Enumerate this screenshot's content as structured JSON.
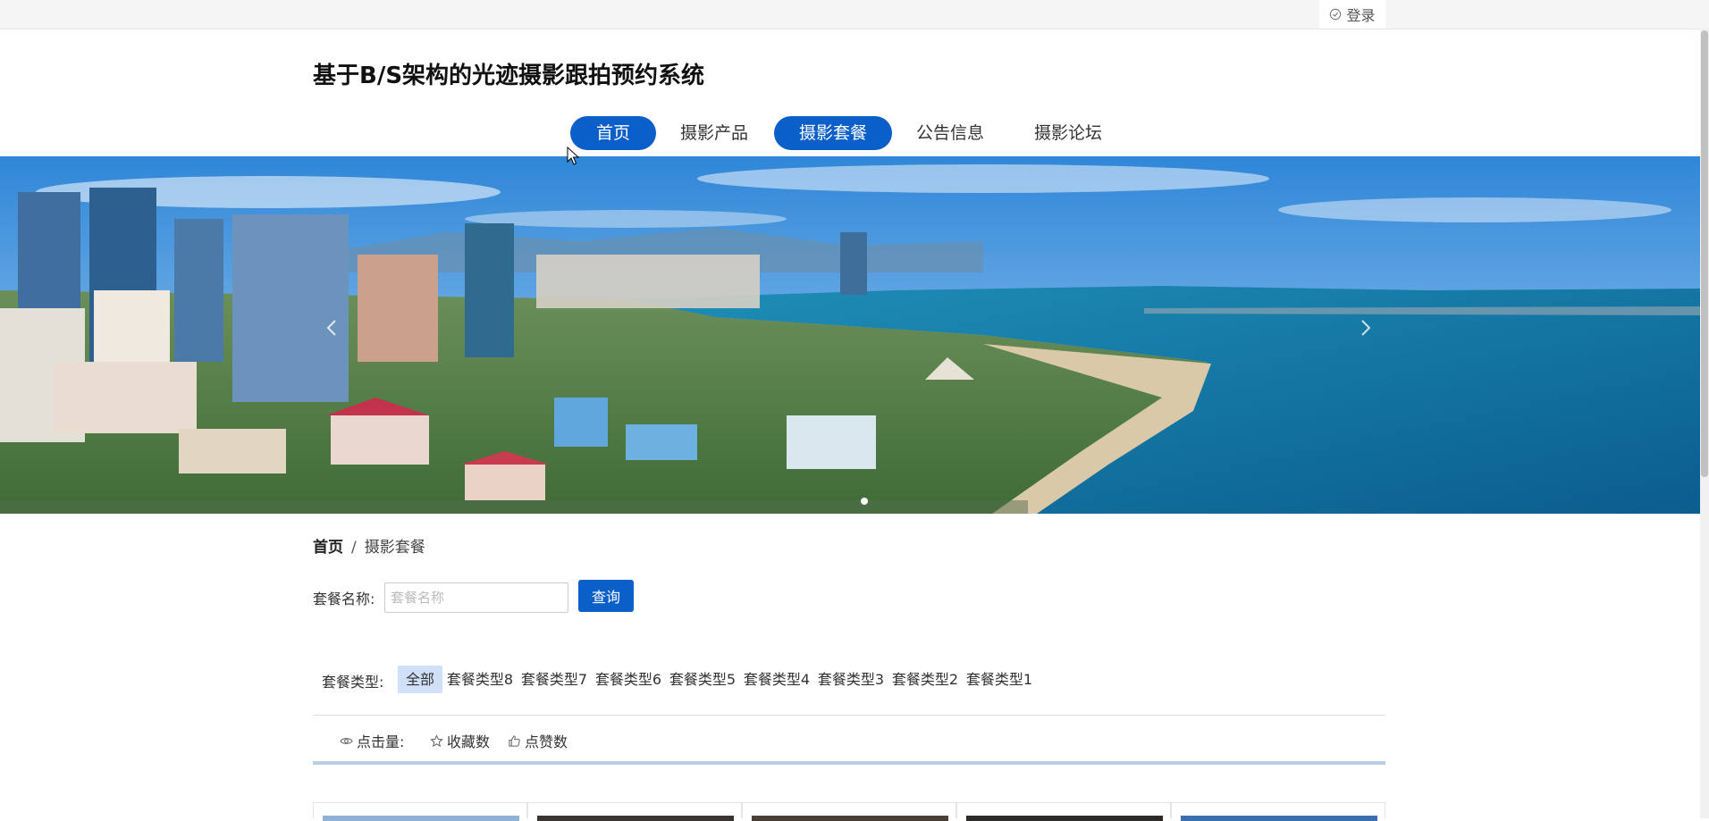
{
  "topbar": {
    "login_label": "登录",
    "login_icon": "check-circle-icon"
  },
  "site": {
    "title": "基于B/S架构的光迹摄影跟拍预约系统"
  },
  "nav": {
    "items": [
      {
        "label": "首页",
        "active": true
      },
      {
        "label": "摄影产品",
        "active": false
      },
      {
        "label": "摄影套餐",
        "active": true
      },
      {
        "label": "公告信息",
        "active": false
      },
      {
        "label": "摄影论坛",
        "active": false
      }
    ],
    "active_color": "#0b5fc8"
  },
  "banner": {
    "prev_icon": "chevron-left-icon",
    "next_icon": "chevron-right-icon"
  },
  "breadcrumb": {
    "home": "首页",
    "separator": "/",
    "current": "摄影套餐"
  },
  "search": {
    "label": "套餐名称:",
    "placeholder": "套餐名称",
    "value": "",
    "button": "查询"
  },
  "types": {
    "label": "套餐类型:",
    "items": [
      "全部",
      "套餐类型8",
      "套餐类型7",
      "套餐类型6",
      "套餐类型5",
      "套餐类型4",
      "套餐类型3",
      "套餐类型2",
      "套餐类型1"
    ],
    "selected": "全部"
  },
  "sort": {
    "label": "点击量:",
    "label_icon": "eye-icon",
    "items": [
      {
        "label": "收藏数",
        "icon": "star-icon"
      },
      {
        "label": "点赞数",
        "icon": "thumbs-up-icon"
      }
    ]
  }
}
